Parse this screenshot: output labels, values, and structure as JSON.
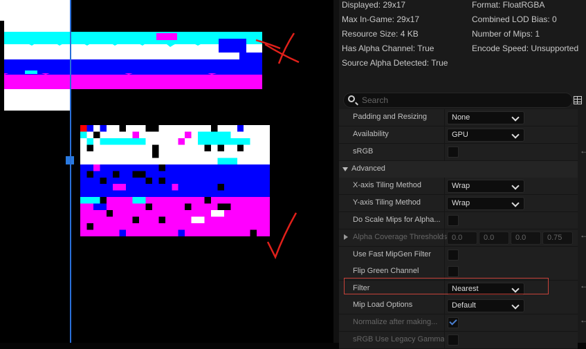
{
  "info": {
    "displayed": "Displayed: 29x17",
    "max_in_game": "Max In-Game: 29x17",
    "resource_size": "Resource Size: 4 KB",
    "has_alpha": "Has Alpha Channel: True",
    "source_alpha": "Source Alpha Detected: True",
    "format": "Format: FloatRGBA",
    "lod_bias": "Combined LOD Bias: 0",
    "num_mips": "Number of Mips: 1",
    "encode_speed": "Encode Speed: Unsupported"
  },
  "search": {
    "placeholder": "Search"
  },
  "properties": {
    "padding": {
      "label": "Padding and Resizing",
      "value": "None"
    },
    "availability": {
      "label": "Availability",
      "value": "GPU"
    },
    "srgb": {
      "label": "sRGB",
      "checked": false
    },
    "advanced": {
      "label": "Advanced"
    },
    "x_tiling": {
      "label": "X-axis Tiling Method",
      "value": "Wrap"
    },
    "y_tiling": {
      "label": "Y-axis Tiling Method",
      "value": "Wrap"
    },
    "scale_mips": {
      "label": "Do Scale Mips for Alpha...",
      "checked": false
    },
    "alpha_coverage": {
      "label": "Alpha Coverage Thresholds",
      "values": [
        "0.0",
        "0.0",
        "0.0",
        "0.75"
      ]
    },
    "fast_mipgen": {
      "label": "Use Fast MipGen Filter",
      "checked": false
    },
    "flip_green": {
      "label": "Flip Green Channel",
      "checked": false
    },
    "filter": {
      "label": "Filter",
      "value": "Nearest"
    },
    "mip_load": {
      "label": "Mip Load Options",
      "value": "Default"
    },
    "normalize": {
      "label": "Normalize after making...",
      "checked": true
    },
    "srgb_legacy": {
      "label": "sRGB Use Legacy Gamma",
      "checked": false
    }
  },
  "colors": {
    "cyan": "#00ffff",
    "blue": "#0000ff",
    "magenta": "#ff00ff",
    "annotation_red": "#e0201a",
    "highlight_border": "#c8423a"
  },
  "icons": [
    "search-icon",
    "table-view-icon",
    "chevron-down-icon",
    "expand-arrow-icon",
    "reset-arrow-icon"
  ]
}
